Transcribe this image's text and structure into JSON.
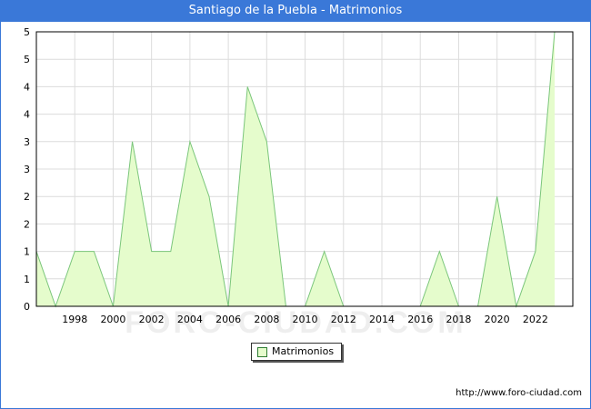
{
  "title": "Santiago de la Puebla - Matrimonios",
  "watermark": "FORO-CIUDAD.COM",
  "source_url": "http://www.foro-ciudad.com",
  "chart_data": {
    "type": "area",
    "x": [
      1996,
      1997,
      1998,
      1999,
      2000,
      2001,
      2002,
      2003,
      2004,
      2005,
      2006,
      2007,
      2008,
      2009,
      2010,
      2011,
      2012,
      2013,
      2014,
      2015,
      2016,
      2017,
      2018,
      2019,
      2020,
      2021,
      2022,
      2023
    ],
    "series": [
      {
        "name": "Matrimonios",
        "values": [
          1,
          0,
          1,
          1,
          0,
          3,
          1,
          1,
          3,
          2,
          0,
          4,
          3,
          0,
          0,
          1,
          0,
          0,
          0,
          0,
          0,
          1,
          0,
          0,
          2,
          0,
          1,
          5
        ],
        "fill": "#e5fccc",
        "line": "#7bc67b"
      }
    ],
    "xticks": [
      "1998",
      "2000",
      "2002",
      "2004",
      "2006",
      "2008",
      "2010",
      "2012",
      "2014",
      "2016",
      "2018",
      "2020",
      "2022"
    ],
    "yticks": [
      "0",
      "1",
      "1",
      "2",
      "2",
      "3",
      "3",
      "4",
      "4",
      "5",
      "5"
    ],
    "ylim": [
      0,
      5
    ],
    "grid": true,
    "legend": "bottom-center"
  }
}
